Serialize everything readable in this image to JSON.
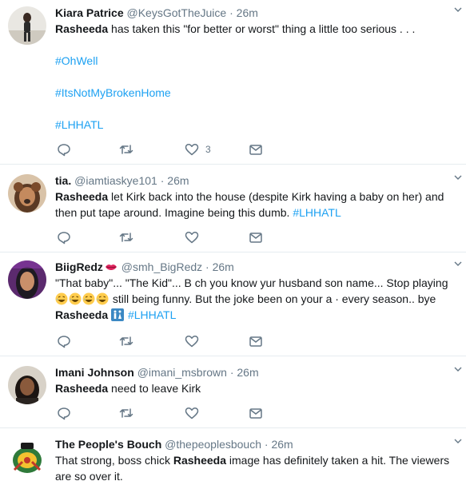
{
  "colors": {
    "link": "#1da1f2",
    "meta": "#657786",
    "text": "#14171a",
    "divider": "#e6ecf0"
  },
  "tweets": [
    {
      "name": "Kiara Patrice",
      "handle": "@KeysGotTheJuice",
      "time": "26m",
      "highlight": "Rasheeda",
      "body": " has taken this \"for better or worst\" thing a little too serious . . .",
      "hashtags": [
        "#OhWell",
        "#ItsNotMyBrokenHome",
        "#LHHATL"
      ],
      "likes": "3",
      "icons": [
        "reply-icon",
        "retweet-icon",
        "heart-icon",
        "message-icon"
      ]
    },
    {
      "name": "tia.",
      "handle": "@iamtiaskye101",
      "time": "26m",
      "highlight": "Rasheeda",
      "body": " let Kirk back into the house (despite Kirk having a baby on her) and then put tape around. Imagine being this dumb. ",
      "hashtag": "#LHHATL"
    },
    {
      "name": "BiigRedz",
      "name_icon": "kiss-lips-icon",
      "handle": "@smh_BigRedz",
      "time": "26m",
      "line1": "\"That baby\"... \"The Kid\"... B  ch you know yur husband son name... Stop playing",
      "line2": " still being funny. But the joke been on your a  · every season..  bye",
      "emoji_name": "laughing-emoji",
      "highlight": "Rasheeda",
      "hashtag": "#LHHATL",
      "tag_icon": "restroom-icon"
    },
    {
      "name": "Imani Johnson",
      "handle": "@imani_msbrown",
      "time": "26m",
      "highlight": "Rasheeda",
      "body": " need to leave Kirk"
    },
    {
      "name": "The People's Bouch",
      "handle": "@thepeoplesbouch",
      "time": "26m",
      "before": "That strong, boss chick ",
      "highlight": "Rasheeda",
      "after": " image has definitely taken a hit. The viewers are so over it."
    }
  ]
}
